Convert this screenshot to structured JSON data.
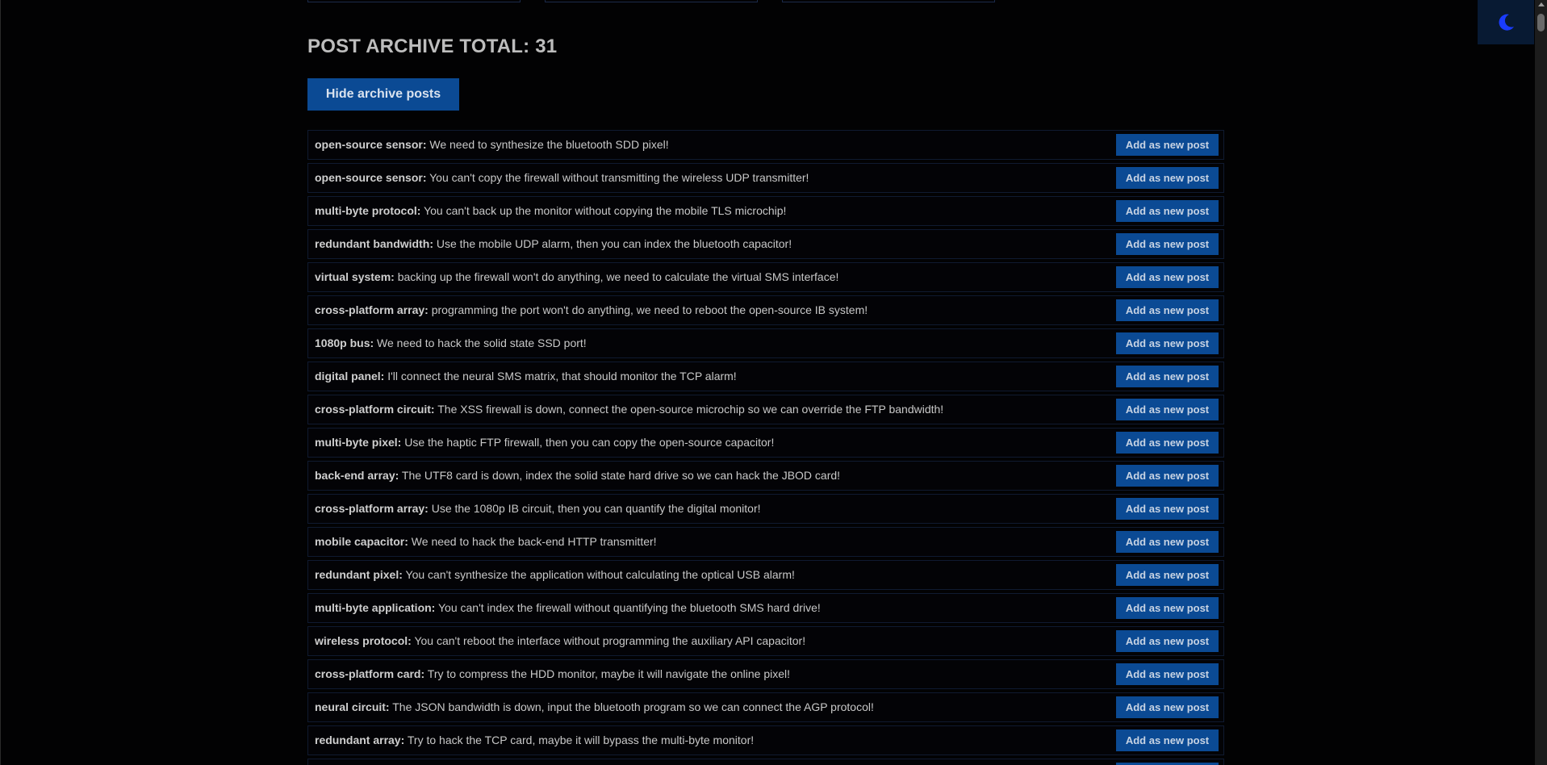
{
  "archive": {
    "title": "POST ARCHIVE TOTAL: 31",
    "hide_button_label": "Hide archive posts"
  },
  "add_button_label": "Add as new post",
  "theme_toggle": {
    "icon": "moon-icon",
    "color": "#1a3cff"
  },
  "colors": {
    "accent": "#0b4a94",
    "background": "#020203"
  },
  "posts": [
    {
      "author": "open-source sensor:",
      "message": " We need to synthesize the bluetooth SDD pixel!"
    },
    {
      "author": "open-source sensor:",
      "message": " You can't copy the firewall without transmitting the wireless UDP transmitter!"
    },
    {
      "author": "multi-byte protocol:",
      "message": " You can't back up the monitor without copying the mobile TLS microchip!"
    },
    {
      "author": "redundant bandwidth:",
      "message": " Use the mobile UDP alarm, then you can index the bluetooth capacitor!"
    },
    {
      "author": "virtual system:",
      "message": " backing up the firewall won't do anything, we need to calculate the virtual SMS interface!"
    },
    {
      "author": "cross-platform array:",
      "message": " programming the port won't do anything, we need to reboot the open-source IB system!"
    },
    {
      "author": "1080p bus:",
      "message": " We need to hack the solid state SSD port!"
    },
    {
      "author": "digital panel:",
      "message": " I'll connect the neural SMS matrix, that should monitor the TCP alarm!"
    },
    {
      "author": "cross-platform circuit:",
      "message": " The XSS firewall is down, connect the open-source microchip so we can override the FTP bandwidth!"
    },
    {
      "author": "multi-byte pixel:",
      "message": " Use the haptic FTP firewall, then you can copy the open-source capacitor!"
    },
    {
      "author": "back-end array:",
      "message": " The UTF8 card is down, index the solid state hard drive so we can hack the JBOD card!"
    },
    {
      "author": "cross-platform array:",
      "message": " Use the 1080p IB circuit, then you can quantify the digital monitor!"
    },
    {
      "author": "mobile capacitor:",
      "message": " We need to hack the back-end HTTP transmitter!"
    },
    {
      "author": "redundant pixel:",
      "message": " You can't synthesize the application without calculating the optical USB alarm!"
    },
    {
      "author": "multi-byte application:",
      "message": " You can't index the firewall without quantifying the bluetooth SMS hard drive!"
    },
    {
      "author": "wireless protocol:",
      "message": " You can't reboot the interface without programming the auxiliary API capacitor!"
    },
    {
      "author": "cross-platform card:",
      "message": " Try to compress the HDD monitor, maybe it will navigate the online pixel!"
    },
    {
      "author": "neural circuit:",
      "message": " The JSON bandwidth is down, input the bluetooth program so we can connect the AGP protocol!"
    },
    {
      "author": "redundant array:",
      "message": " Try to hack the TCP card, maybe it will bypass the multi-byte monitor!"
    },
    {
      "author": "",
      "message": ""
    }
  ]
}
